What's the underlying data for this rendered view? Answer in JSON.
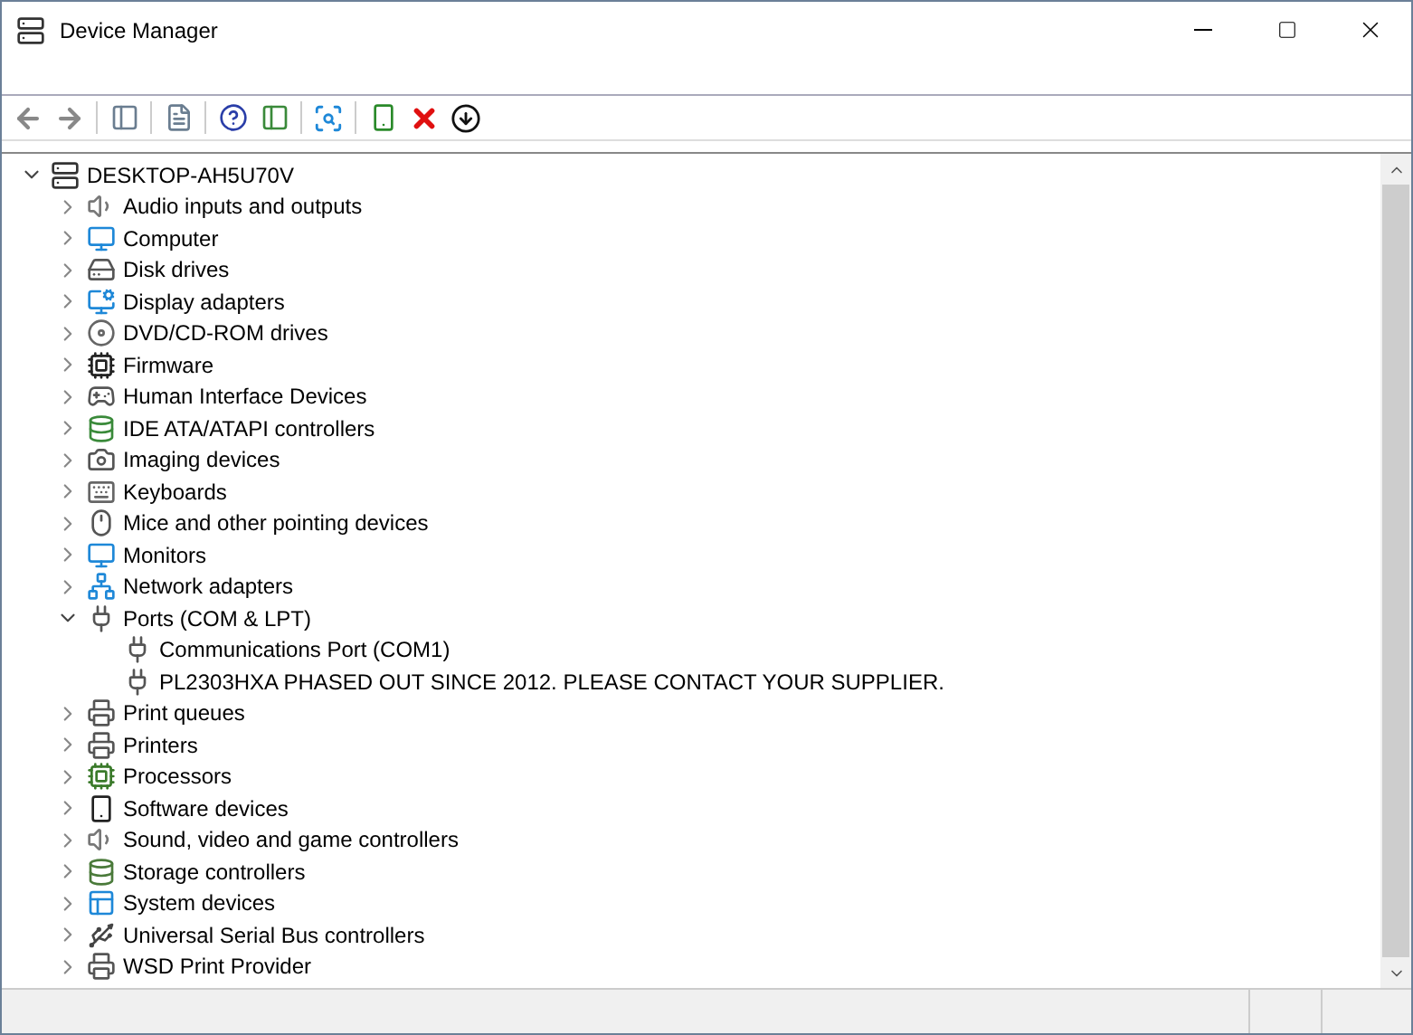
{
  "window": {
    "title": "Device Manager"
  },
  "tree": {
    "label": "DESKTOP-AH5U70V",
    "kind": "computer",
    "expanded": true,
    "children": [
      {
        "label": "Audio inputs and outputs",
        "kind": "speaker",
        "expanded": false
      },
      {
        "label": "Computer",
        "kind": "monitor",
        "expanded": false
      },
      {
        "label": "Disk drives",
        "kind": "disk",
        "expanded": false
      },
      {
        "label": "Display adapters",
        "kind": "display",
        "expanded": false
      },
      {
        "label": "DVD/CD-ROM drives",
        "kind": "disc",
        "expanded": false
      },
      {
        "label": "Firmware",
        "kind": "chip",
        "expanded": false
      },
      {
        "label": "Human Interface Devices",
        "kind": "hid",
        "expanded": false
      },
      {
        "label": "IDE ATA/ATAPI controllers",
        "kind": "ide",
        "expanded": false
      },
      {
        "label": "Imaging devices",
        "kind": "camera",
        "expanded": false
      },
      {
        "label": "Keyboards",
        "kind": "keyboard",
        "expanded": false
      },
      {
        "label": "Mice and other pointing devices",
        "kind": "mouse",
        "expanded": false
      },
      {
        "label": "Monitors",
        "kind": "monitor",
        "expanded": false
      },
      {
        "label": "Network adapters",
        "kind": "network",
        "expanded": false
      },
      {
        "label": "Ports (COM & LPT)",
        "kind": "port",
        "expanded": true,
        "children": [
          {
            "label": "Communications Port (COM1)",
            "kind": "port"
          },
          {
            "label": "PL2303HXA PHASED OUT SINCE 2012. PLEASE CONTACT YOUR SUPPLIER.",
            "kind": "port"
          }
        ]
      },
      {
        "label": "Print queues",
        "kind": "printer",
        "expanded": false
      },
      {
        "label": "Printers",
        "kind": "printer",
        "expanded": false
      },
      {
        "label": "Processors",
        "kind": "cpu",
        "expanded": false
      },
      {
        "label": "Software devices",
        "kind": "software",
        "expanded": false
      },
      {
        "label": "Sound, video and game controllers",
        "kind": "speaker",
        "expanded": false
      },
      {
        "label": "Storage controllers",
        "kind": "storage",
        "expanded": false
      },
      {
        "label": "System devices",
        "kind": "system",
        "expanded": false
      },
      {
        "label": "Universal Serial Bus controllers",
        "kind": "usb",
        "expanded": false
      },
      {
        "label": "WSD Print Provider",
        "kind": "printer",
        "expanded": false
      }
    ]
  }
}
